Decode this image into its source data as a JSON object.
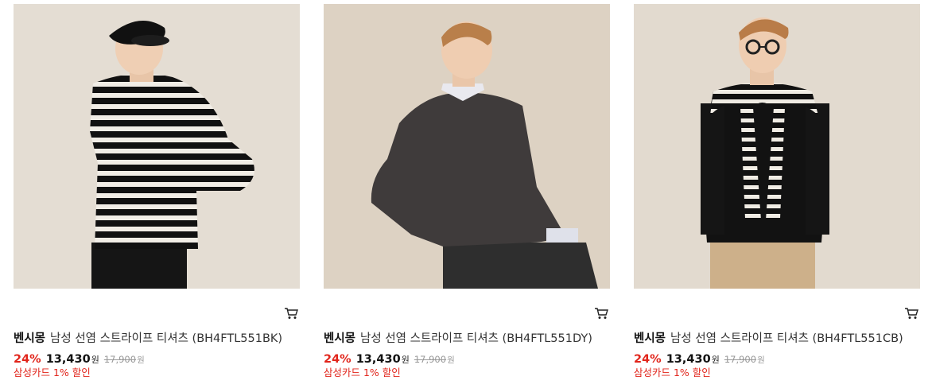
{
  "products": [
    {
      "brand": "벤시몽",
      "name": "남성 선염 스트라이프 티셔츠 (BH4FTL551BK)",
      "discount_rate": "24%",
      "sale_price": "13,430",
      "currency": "원",
      "original_price": "17,900",
      "card_promo": "삼성카드 1% 할인",
      "image_desc": "model-striped-tshirt-black"
    },
    {
      "brand": "벤시몽",
      "name": "남성 선염 스트라이프 티셔츠 (BH4FTL551DY)",
      "discount_rate": "24%",
      "sale_price": "13,430",
      "currency": "원",
      "original_price": "17,900",
      "card_promo": "삼성카드 1% 할인",
      "image_desc": "model-sweatshirt-dark-grey"
    },
    {
      "brand": "벤시몽",
      "name": "남성 선염 스트라이프 티셔츠 (BH4FTL551CB)",
      "discount_rate": "24%",
      "sale_price": "13,430",
      "currency": "원",
      "original_price": "17,900",
      "card_promo": "삼성카드 1% 할인",
      "image_desc": "model-black-tee-striped-shoulder"
    }
  ],
  "icons": {
    "cart": "cart-icon"
  },
  "colors": {
    "discount": "#e1251b",
    "promo": "#e1251b",
    "original_price": "#999999"
  }
}
